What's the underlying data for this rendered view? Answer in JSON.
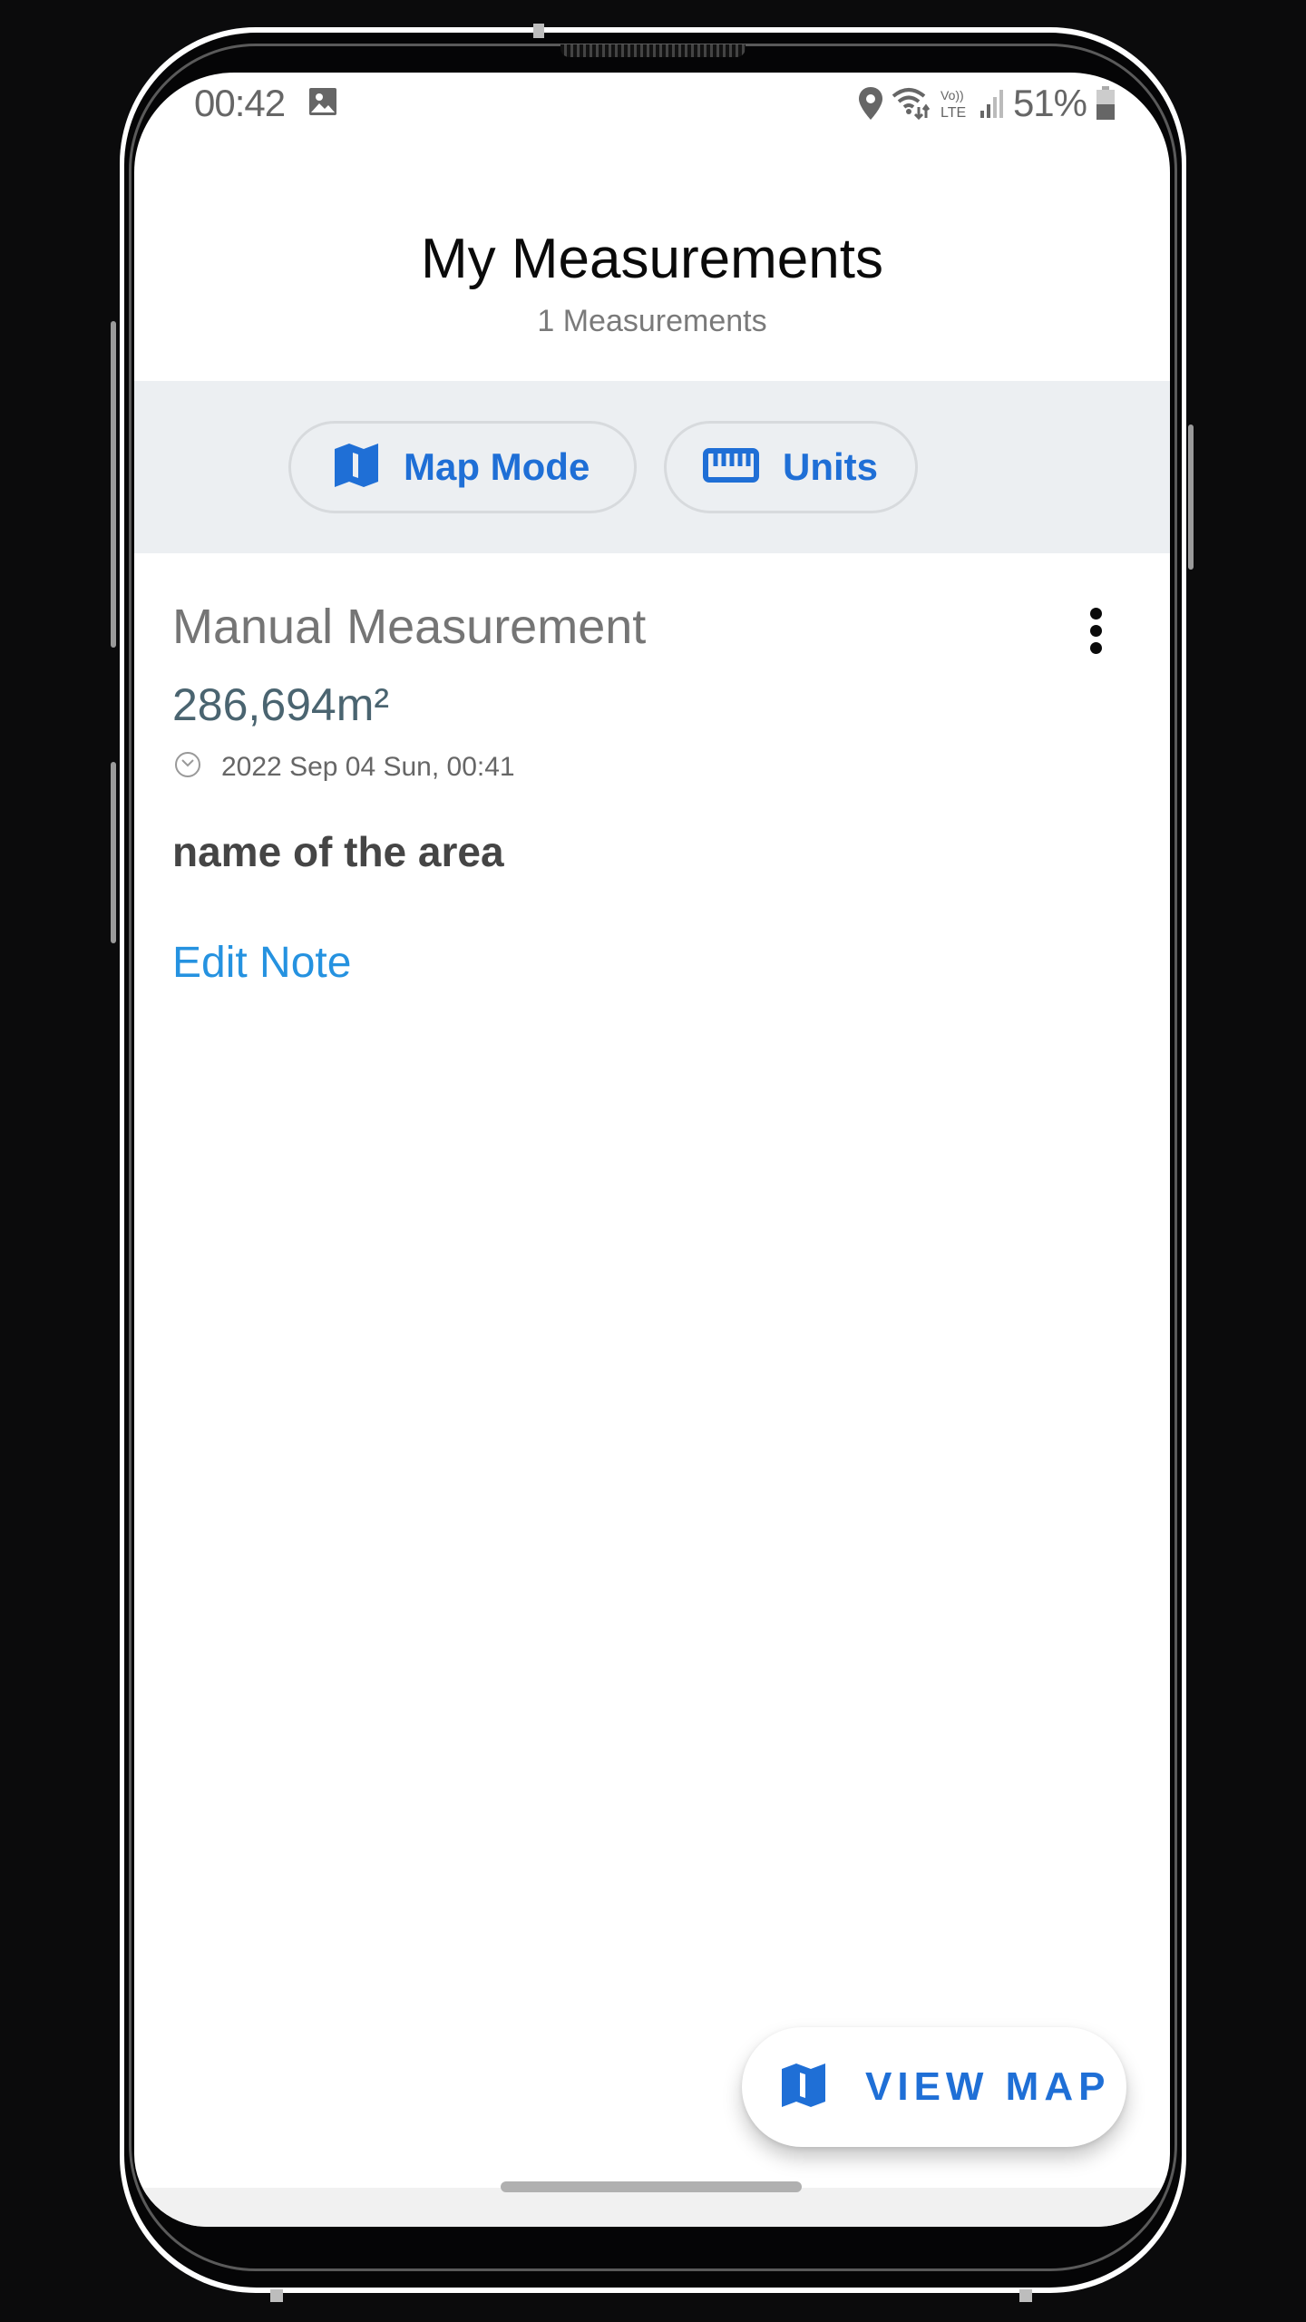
{
  "status_bar": {
    "time": "00:42",
    "left_icons": [
      "gallery-icon"
    ],
    "right_icons": [
      "location-icon",
      "wifi-icon",
      "volte-lte-icon",
      "signal-icon",
      "battery-icon"
    ],
    "volte_label": "Vo)) LTE",
    "battery_percent": "51%"
  },
  "header": {
    "title": "My Measurements",
    "subtitle": "1 Measurements"
  },
  "toolbar": {
    "map_mode": {
      "label": "Map Mode",
      "icon": "map-icon"
    },
    "units": {
      "label": "Units",
      "icon": "ruler-icon"
    }
  },
  "measurement": {
    "title": "Manual Measurement",
    "area": "286,694m²",
    "date": "2022 Sep 04 Sun, 00:41",
    "note": "name of the area",
    "edit_note_label": "Edit Note",
    "menu_icon": "more-vert-icon"
  },
  "fab": {
    "label": "VIEW MAP",
    "icon": "map-icon"
  },
  "colors": {
    "accent": "#1f6fd6",
    "link": "#2592e0",
    "area_value": "#4a6470",
    "toolbar_bg": "#eceff2"
  }
}
